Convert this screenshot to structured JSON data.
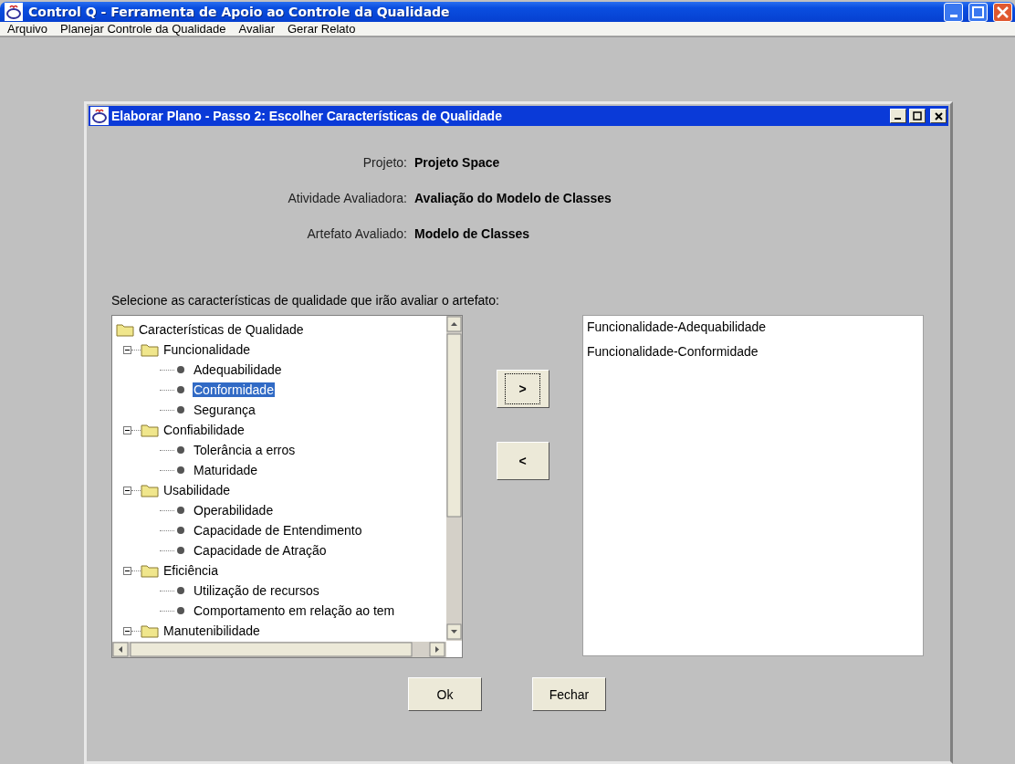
{
  "window": {
    "title": "Control Q - Ferramenta de Apoio ao Controle da Qualidade"
  },
  "menu": [
    "Arquivo",
    "Planejar Controle da Qualidade",
    "Avaliar",
    "Gerar Relato"
  ],
  "dialog": {
    "title": "Elaborar Plano - Passo 2: Escolher Características de Qualidade",
    "fields": [
      {
        "label": "Projeto:",
        "value": "Projeto Space"
      },
      {
        "label": "Atividade Avaliadora:",
        "value": "Avaliação do Modelo de Classes"
      },
      {
        "label": "Artefato Avaliado:",
        "value": "Modelo de Classes"
      }
    ],
    "instruction": "Selecione as características de qualidade que irão avaliar o artefato:",
    "tree": {
      "label": "Características de Qualidade",
      "kind": "folder",
      "children": [
        {
          "label": "Funcionalidade",
          "kind": "folder",
          "expanded": true,
          "children": [
            {
              "label": "Adequabilidade",
              "kind": "leaf",
              "selected": false
            },
            {
              "label": "Conformidade",
              "kind": "leaf",
              "selected": true
            },
            {
              "label": "Segurança",
              "kind": "leaf",
              "selected": false
            }
          ]
        },
        {
          "label": "Confiabilidade",
          "kind": "folder",
          "expanded": true,
          "children": [
            {
              "label": "Tolerância a erros",
              "kind": "leaf",
              "selected": false
            },
            {
              "label": "Maturidade",
              "kind": "leaf",
              "selected": false
            }
          ]
        },
        {
          "label": "Usabilidade",
          "kind": "folder",
          "expanded": true,
          "children": [
            {
              "label": "Operabilidade",
              "kind": "leaf",
              "selected": false
            },
            {
              "label": "Capacidade de Entendimento",
              "kind": "leaf",
              "selected": false
            },
            {
              "label": "Capacidade de Atração",
              "kind": "leaf",
              "selected": false
            }
          ]
        },
        {
          "label": "Eficiência",
          "kind": "folder",
          "expanded": true,
          "children": [
            {
              "label": "Utilização de recursos",
              "kind": "leaf",
              "selected": false
            },
            {
              "label": "Comportamento em relação ao tem",
              "kind": "leaf",
              "selected": false
            }
          ]
        },
        {
          "label": "Manutenibilidade",
          "kind": "folder",
          "expanded": true
        }
      ]
    },
    "move_buttons": [
      {
        "label": ">",
        "focused": true
      },
      {
        "label": "<",
        "focused": false
      }
    ],
    "chosen": [
      "Funcionalidade-Adequabilidade",
      "Funcionalidade-Conformidade"
    ],
    "buttons": [
      "Ok",
      "Fechar"
    ]
  }
}
